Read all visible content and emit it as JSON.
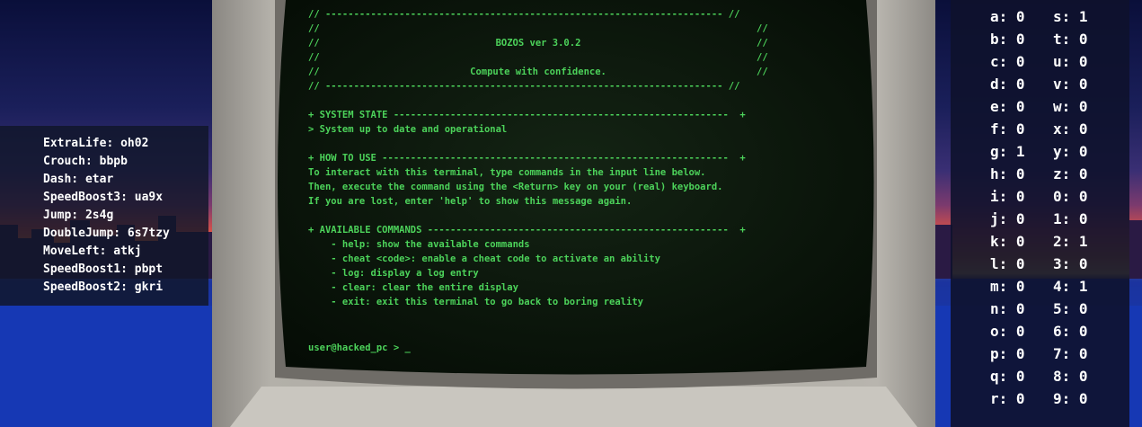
{
  "terminal": {
    "banner_rule": "// ---------------------------------------------------------------------- //",
    "banner_edge_left": "//",
    "banner_edge_right": "//",
    "os_name": "BOZOS ver 3.0.2",
    "tagline": "Compute with confidence.",
    "system_state_header": "+ SYSTEM STATE -----------------------------------------------------------  +",
    "system_state_text": "> System up to date and operational",
    "how_to_use_header": "+ HOW TO USE -------------------------------------------------------------  +",
    "how_to_use_lines": [
      "To interact with this terminal, type commands in the input line below.",
      "Then, execute the command using the <Return> key on your (real) keyboard.",
      "If you are lost, enter 'help' to show this message again."
    ],
    "commands_header": "+ AVAILABLE COMMANDS -----------------------------------------------------  +",
    "commands": [
      "    - help: show the available commands",
      "    - cheat <code>: enable a cheat code to activate an ability",
      "    - log: display a log entry",
      "    - clear: clear the entire display",
      "    - exit: exit this terminal to go back to boring reality"
    ],
    "prompt": "user@hacked_pc > _"
  },
  "cheat_codes": [
    "ExtraLife: oh02",
    "Crouch: bbpb",
    "Dash: etar",
    "SpeedBoost3: ua9x",
    "Jump: 2s4g",
    "DoubleJump: 6s7tzy",
    "MoveLeft: atkj",
    "SpeedBoost1: pbpt",
    "SpeedBoost2: gkri"
  ],
  "key_counters_left": [
    "a: 0",
    "b: 0",
    "c: 0",
    "d: 0",
    "e: 0",
    "f: 0",
    "g: 1",
    "h: 0",
    "i: 0",
    "j: 0",
    "k: 0",
    "l: 0",
    "m: 0",
    "n: 0",
    "o: 0",
    "p: 0",
    "q: 0",
    "r: 0"
  ],
  "key_counters_right": [
    "s: 1",
    "t: 0",
    "u: 0",
    "v: 0",
    "w: 0",
    "x: 0",
    "y: 0",
    "z: 0",
    "0: 0",
    "1: 0",
    "2: 1",
    "3: 0",
    "4: 1",
    "5: 0",
    "6: 0",
    "7: 0",
    "8: 0",
    "9: 0"
  ],
  "colors": {
    "terminal_text": "#4cd25a",
    "screen_bg": "#0c170c",
    "monitor_bezel": "#9d9a94",
    "sky_top": "#0a0f3a",
    "sunset": "#f08a2c",
    "city": "#2a1a44",
    "water": "#1836b0"
  }
}
